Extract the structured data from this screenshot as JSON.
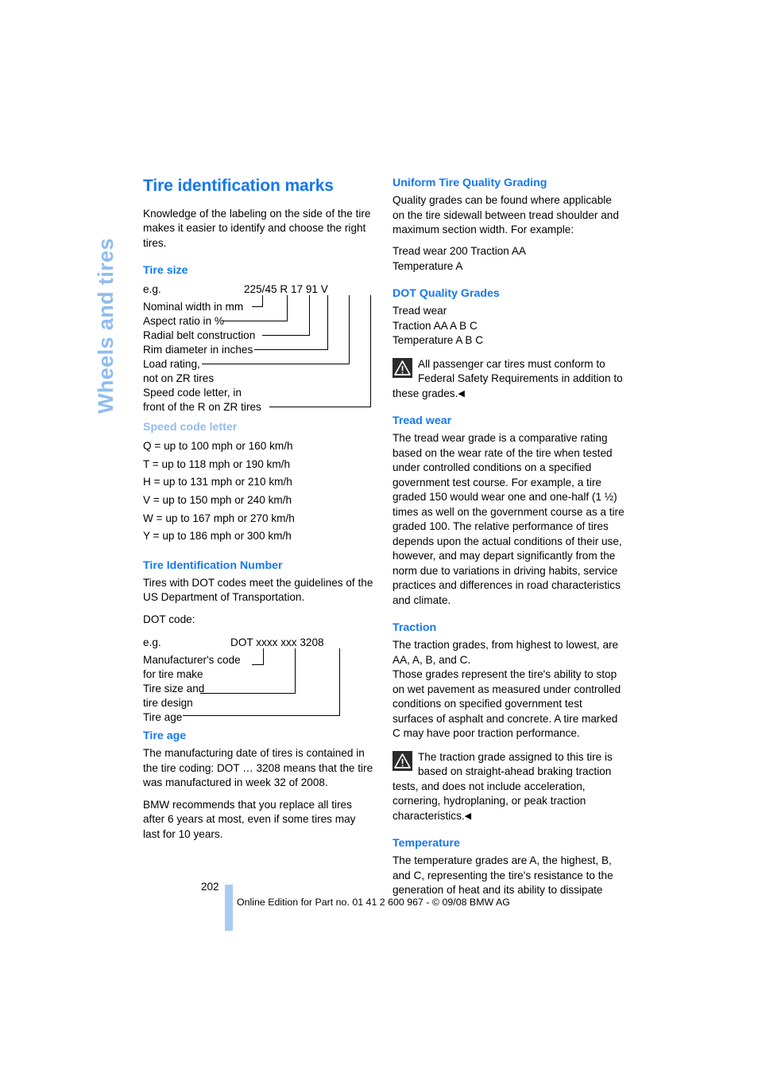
{
  "chapter": {
    "vertical_title": "Wheels and tires"
  },
  "page": {
    "number": "202",
    "footer": "Online Edition for Part no. 01 41 2 600 967  - © 09/08 BMW AG"
  },
  "left_column": {
    "title": "Tire identification marks",
    "intro": "Knowledge of the labeling on the side of the tire makes it easier to identify and choose the right tires.",
    "tire_size": {
      "heading": "Tire size",
      "eg_label": "e.g.",
      "example_code": "225/45  R  17  91   V",
      "code_parts": {
        "width": "225/45",
        "construction": "R",
        "rim": "17",
        "load": "91",
        "speed": "V"
      },
      "labels": [
        "Nominal width in mm",
        "Aspect ratio in %",
        "Radial belt construction",
        "Rim diameter in inches",
        "Load rating,",
        "not on ZR tires",
        "Speed code letter, in",
        "front of the R on ZR tires"
      ]
    },
    "speed_code": {
      "heading": "Speed code letter",
      "entries": [
        "Q = up to 100 mph or 160 km/h",
        "T = up to 118 mph or 190 km/h",
        "H = up to 131 mph or 210 km/h",
        "V = up to 150 mph or 240 km/h",
        "W = up to 167 mph or 270 km/h",
        "Y = up to 186 mph or 300 km/h"
      ]
    },
    "tin": {
      "heading": "Tire Identification Number",
      "body": "Tires with DOT codes meet the guidelines of the US Department of Transportation.",
      "dot_code_label": "DOT code:",
      "eg_label": "e.g.",
      "example_code": "DOT xxxx xxx 3208",
      "labels": [
        "Manufacturer's code",
        "for tire make",
        "Tire size and",
        "tire design",
        "Tire age"
      ]
    },
    "tire_age": {
      "heading": "Tire age",
      "p1": "The manufacturing date of tires is contained in the tire coding: DOT … 3208 means that the tire was manufactured in week 32 of 2008.",
      "p2": "BMW recommends that you replace all tires after 6 years at most, even if some tires may last for 10 years."
    }
  },
  "right_column": {
    "utqg": {
      "heading": "Uniform Tire Quality Grading",
      "body": "Quality grades can be found where applicable on the tire sidewall between tread shoulder and maximum section width. For example:",
      "example_line1": "Tread wear 200 Traction AA",
      "example_line2": "Temperature A"
    },
    "dot_grades": {
      "heading": "DOT Quality Grades",
      "line1": "Tread wear",
      "line2": "Traction AA A B C",
      "line3": "Temperature A B C"
    },
    "note1": {
      "text": "All passenger car tires must conform to Federal Safety Requirements in addition to these grades.",
      "endmark": "◀"
    },
    "tread_wear": {
      "heading": "Tread wear",
      "body": "The tread wear grade is a comparative rating based on the wear rate of the tire when tested under controlled conditions on a specified government test course. For example, a tire graded 150 would wear one and one-half (1 ½) times as well on the government course as a tire graded 100. The relative performance of tires depends upon the actual conditions of their use, however, and may depart significantly from the norm due to variations in driving habits, service practices and differences in road characteristics and climate."
    },
    "traction": {
      "heading": "Traction",
      "body1": "The traction grades, from highest to lowest, are AA, A, B, and C.",
      "body2": "Those grades represent the tire's ability to stop on wet pavement as measured under controlled conditions on specified government test surfaces of asphalt and concrete. A tire marked C may have poor traction performance."
    },
    "note2": {
      "text": "The traction grade assigned to this tire is based on straight-ahead braking traction tests, and does not include acceleration, cornering, hydroplaning, or peak traction characteristics.",
      "endmark": "◀"
    },
    "temperature": {
      "heading": "Temperature",
      "body": "The temperature grades are A, the highest, B, and C, representing the tire's resistance to the generation of heat and its ability to dissipate"
    }
  },
  "colors": {
    "heading_blue": "#1478f0",
    "pale_blue": "#8fbcf0",
    "bar_blue": "#a9cbf2"
  }
}
